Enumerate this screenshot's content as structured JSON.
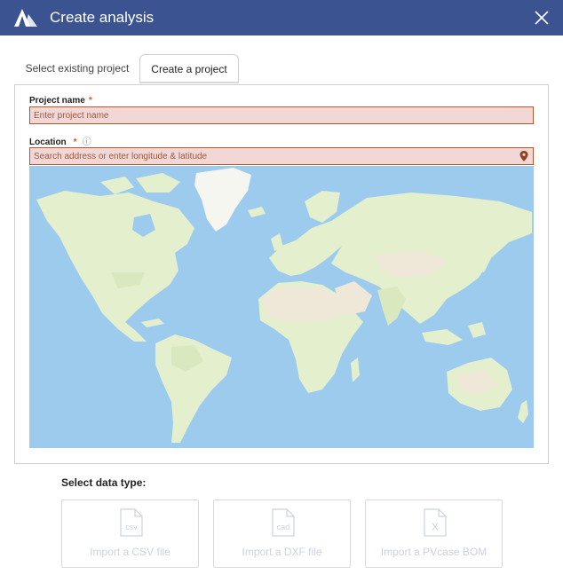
{
  "window": {
    "title": "Create analysis",
    "logo_icon": "app-logo-icon",
    "close_icon": "close-icon"
  },
  "tabs": [
    {
      "label": "Select existing project",
      "active": false
    },
    {
      "label": "Create a project",
      "active": true
    }
  ],
  "form": {
    "project_name": {
      "label": "Project name",
      "required_mark": "*",
      "placeholder": "Enter project name",
      "value": ""
    },
    "location": {
      "label": "Location",
      "required_mark": "*",
      "info_glyph": "ⓘ",
      "placeholder": "Search address or enter longitude & latitude",
      "value": "",
      "pin_icon": "map-pin-icon"
    }
  },
  "map": {
    "ocean_color": "#9ccbed",
    "land_color": "#e4efce",
    "desert_color": "#efe8d8",
    "ice_color": "#f6f6f1"
  },
  "data_type": {
    "label": "Select data type:",
    "options": [
      {
        "label": "Import a CSV file",
        "icon_text": "csv",
        "icon": "csv-file-icon"
      },
      {
        "label": "Import a DXF file",
        "icon_text": "cad",
        "icon": "cad-file-icon"
      },
      {
        "label": "Import a PVcase BOM",
        "icon_text": "X",
        "icon": "excel-file-icon"
      }
    ]
  },
  "colors": {
    "header": "#3b5391",
    "error_border": "#b1572c",
    "error_fill": "#f2d7d7",
    "disabled_text": "#cdd3dc"
  }
}
